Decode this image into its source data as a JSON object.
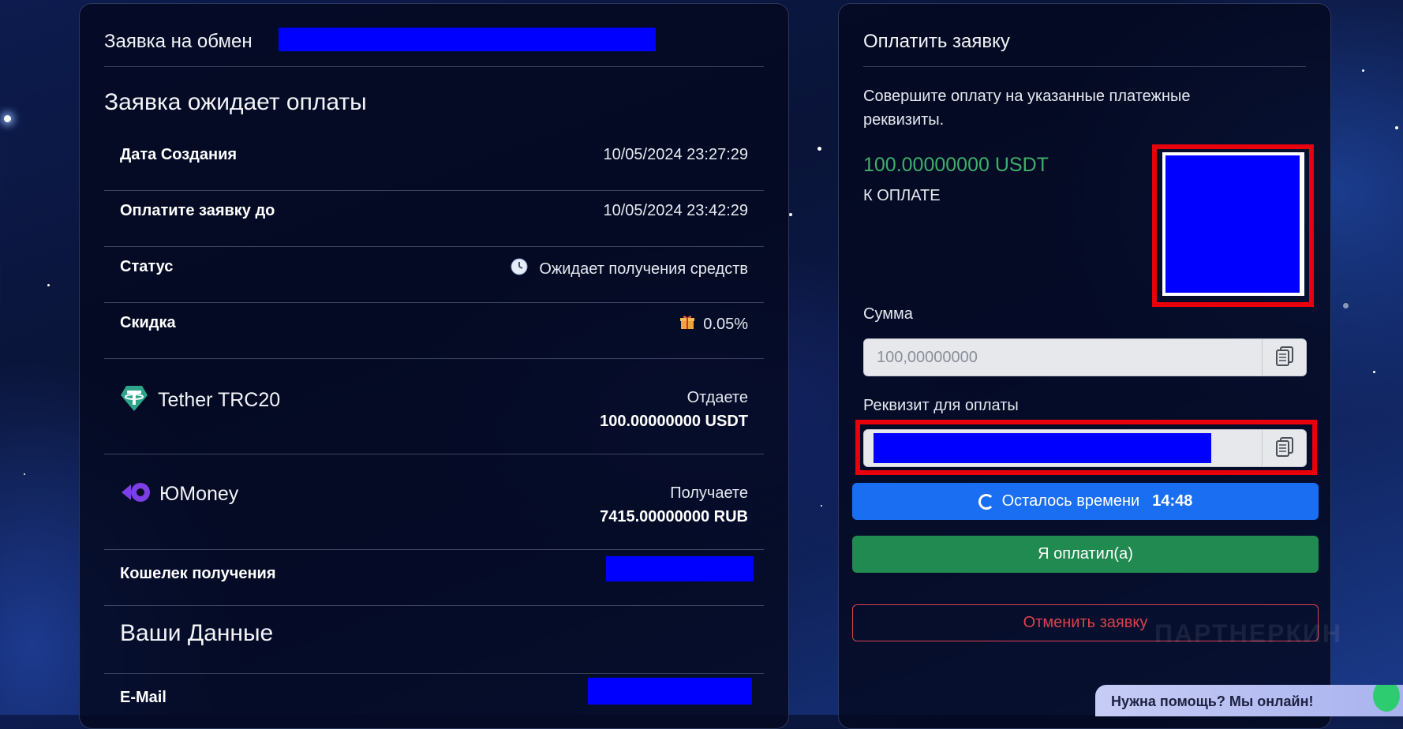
{
  "left": {
    "header_prefix": "Заявка на обмен",
    "status_title": "Заявка ожидает оплаты",
    "rows": {
      "created_label": "Дата Создания",
      "created_value": "10/05/2024 23:27:29",
      "pay_until_label": "Оплатите заявку до",
      "pay_until_value": "10/05/2024 23:42:29",
      "status_label": "Статус",
      "status_value": "Ожидает получения средств",
      "discount_label": "Скидка",
      "discount_value": "0.05%"
    },
    "give": {
      "currency": "Tether TRC20",
      "caption": "Отдаете",
      "amount": "100.00000000 USDT"
    },
    "receive": {
      "currency": "ЮMoney",
      "caption": "Получаете",
      "amount": "7415.00000000 RUB"
    },
    "wallet_label": "Кошелек получения",
    "your_data_title": "Ваши Данные",
    "email_label": "E-Mail"
  },
  "right": {
    "title": "Оплатить заявку",
    "instruction": "Совершите оплату на указанные платежные реквизиты.",
    "amount_due": "100.00000000 USDT",
    "amount_due_caption": "К ОПЛАТЕ",
    "sum_label": "Сумма",
    "sum_value": "100,00000000",
    "requisite_label": "Реквизит для оплаты",
    "timer_label": "Осталось времени",
    "timer_value": "14:48",
    "paid_button": "Я оплатил(а)",
    "cancel_button": "Отменить заявку"
  },
  "watermark": "ПАРТНЕРКИН",
  "help_widget": "Нужна помощь? Мы онлайн!",
  "colors": {
    "accent_blue": "#1a6ef2",
    "success_green": "#218a51",
    "danger_red": "#d9424d",
    "amount_green": "#3fae6a",
    "redaction": "#0000ff",
    "highlight_red": "#e8000b"
  }
}
